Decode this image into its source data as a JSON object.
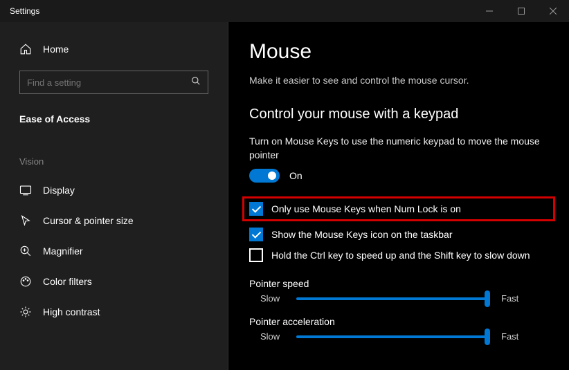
{
  "window": {
    "title": "Settings"
  },
  "sidebar": {
    "home": "Home",
    "search_placeholder": "Find a setting",
    "category": "Ease of Access",
    "section": "Vision",
    "items": [
      {
        "label": "Display"
      },
      {
        "label": "Cursor & pointer size"
      },
      {
        "label": "Magnifier"
      },
      {
        "label": "Color filters"
      },
      {
        "label": "High contrast"
      }
    ]
  },
  "main": {
    "title": "Mouse",
    "subtitle": "Make it easier to see and control the mouse cursor.",
    "section_title": "Control your mouse with a keypad",
    "desc": "Turn on Mouse Keys to use the numeric keypad to move the mouse pointer",
    "toggle_state": "On",
    "checks": [
      {
        "label": "Only use Mouse Keys when Num Lock is on",
        "checked": true,
        "highlight": true
      },
      {
        "label": "Show the Mouse Keys icon on the taskbar",
        "checked": true,
        "highlight": false
      },
      {
        "label": "Hold the Ctrl key to speed up and the Shift key to slow down",
        "checked": false,
        "highlight": false
      }
    ],
    "sliders": [
      {
        "label": "Pointer speed",
        "min": "Slow",
        "max": "Fast"
      },
      {
        "label": "Pointer acceleration",
        "min": "Slow",
        "max": "Fast"
      }
    ]
  }
}
